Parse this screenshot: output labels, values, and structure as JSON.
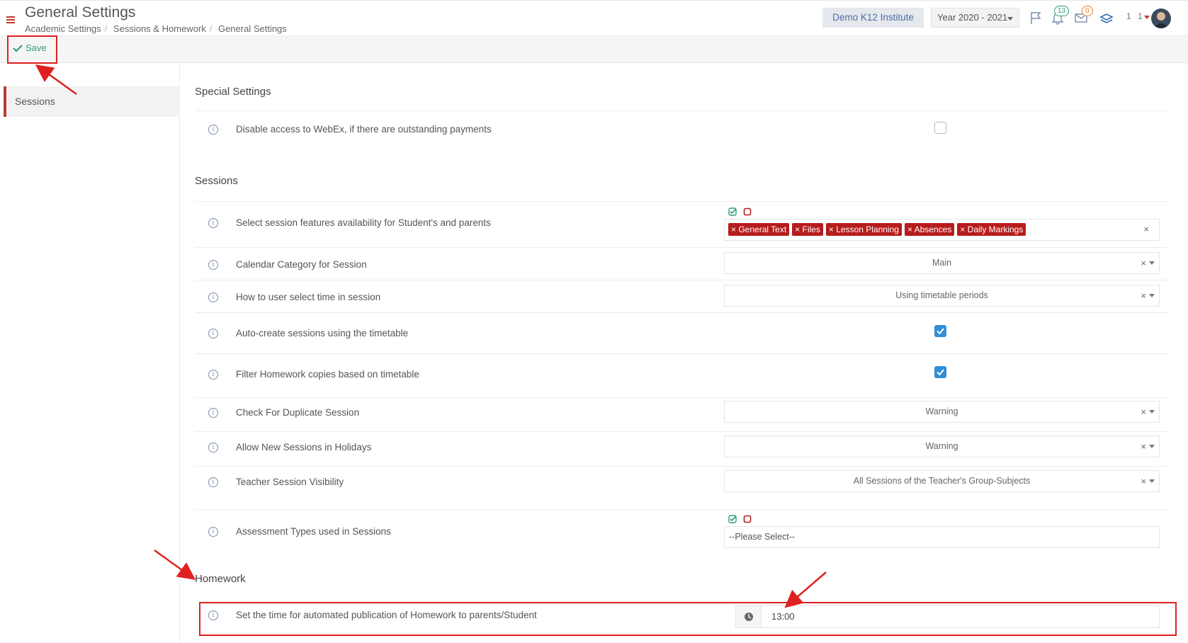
{
  "header": {
    "title": "General Settings",
    "breadcrumb": [
      "Academic Settings",
      "Sessions & Homework",
      "General Settings"
    ],
    "institute": "Demo K12 Institute",
    "year": "Year 2020 - 2021",
    "notifications_count": "13",
    "messages_count": "0",
    "user_label": "1 1"
  },
  "toolbar": {
    "save_label": "Save"
  },
  "sidebar": {
    "items": [
      {
        "label": "Sessions"
      }
    ]
  },
  "special_settings": {
    "title": "Special Settings",
    "rows": [
      {
        "label": "Disable access to WebEx, if there are outstanding payments",
        "checked": false
      }
    ]
  },
  "sessions": {
    "title": "Sessions",
    "features": {
      "label": "Select session features availability for Student's and parents",
      "tags": [
        "General Text",
        "Files",
        "Lesson Planning",
        "Absences",
        "Daily Markings"
      ]
    },
    "calendar_category": {
      "label": "Calendar Category for Session",
      "value": "Main"
    },
    "select_time": {
      "label": "How to user select time in session",
      "value": "Using timetable periods"
    },
    "auto_create": {
      "label": "Auto-create sessions using the timetable",
      "checked": true
    },
    "filter_homework": {
      "label": "Filter Homework copies based on timetable",
      "checked": true
    },
    "duplicate_check": {
      "label": "Check For Duplicate Session",
      "value": "Warning"
    },
    "holidays": {
      "label": "Allow New Sessions in Holidays",
      "value": "Warning"
    },
    "teacher_visibility": {
      "label": "Teacher Session Visibility",
      "value": "All Sessions of the Teacher's Group-Subjects"
    },
    "assessment_types": {
      "label": "Assessment Types used in Sessions",
      "placeholder": "--Please Select--"
    }
  },
  "homework": {
    "title": "Homework",
    "publication_time": {
      "label": "Set the time for automated publication of Homework to parents/Student",
      "value": "13:00"
    }
  },
  "colors": {
    "accent_red": "#c0392b",
    "tag_red": "#b71c1c",
    "check_blue": "#2f8fd8",
    "save_green": "#2e9e6e",
    "annotation_red": "#e02020"
  }
}
